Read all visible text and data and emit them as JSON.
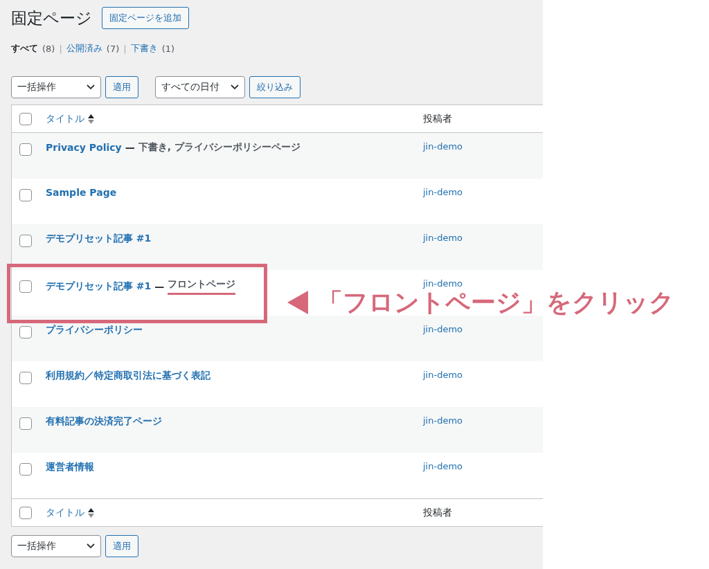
{
  "page_title": "固定ページ",
  "add_button": "固定ページを追加",
  "filters": [
    {
      "label": "すべて",
      "count": "(8)",
      "selected": true
    },
    {
      "label": "公開済み",
      "count": "(7)",
      "selected": false
    },
    {
      "label": "下書き",
      "count": "(1)",
      "selected": false
    }
  ],
  "separator": "|",
  "bulk_action": "一括操作",
  "apply_button": "適用",
  "date_filter": "すべての日付",
  "filter_button": "絞り込み",
  "table": {
    "columns": [
      "タイトル",
      "投稿者"
    ],
    "select_all_checked": false,
    "rows": [
      {
        "title": "Privacy Policy",
        "dash": "—",
        "state": "下書き, プライバシーポリシーページ",
        "author": "jin-demo",
        "highlighted": false,
        "checked": false
      },
      {
        "title": "Sample Page",
        "author": "jin-demo",
        "highlighted": false,
        "checked": false
      },
      {
        "title": "デモプリセット記事 #1",
        "author": "jin-demo",
        "highlighted": false,
        "checked": false
      },
      {
        "title": "デモプリセット記事 #1",
        "dash": "—",
        "state": "フロントページ",
        "author": "jin-demo",
        "highlighted": true,
        "checked": false
      },
      {
        "title": "プライバシーポリシー",
        "author": "jin-demo",
        "highlighted": false,
        "checked": false
      },
      {
        "title": "利用規約／特定商取引法に基づく表記",
        "author": "jin-demo",
        "highlighted": false,
        "checked": false
      },
      {
        "title": "有料記事の決済完了ページ",
        "author": "jin-demo",
        "highlighted": false,
        "checked": false
      },
      {
        "title": "運営者情報",
        "author": "jin-demo",
        "highlighted": false,
        "checked": false
      }
    ],
    "footer_columns": [
      "タイトル",
      "投稿者"
    ]
  },
  "bottom_bulk_action": "一括操作",
  "bottom_apply_button": "適用",
  "callout": "「フロントページ」をクリック"
}
